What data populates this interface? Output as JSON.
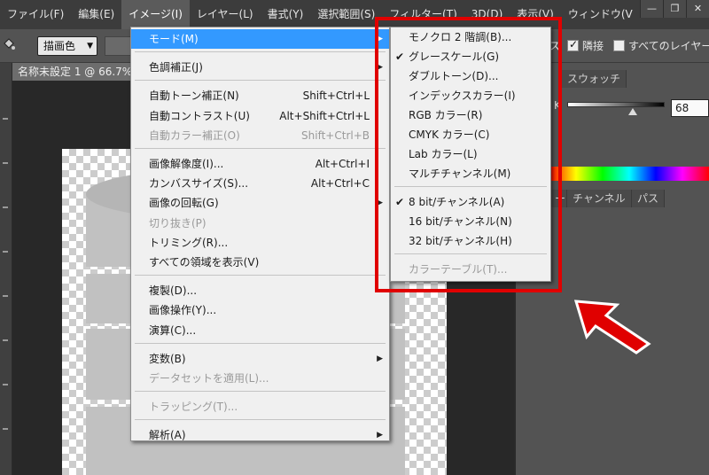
{
  "menubar": {
    "items": [
      "ファイル(F)",
      "編集(E)",
      "イメージ(I)",
      "レイヤー(L)",
      "書式(Y)",
      "選択範囲(S)",
      "フィルター(T)",
      "3D(D)",
      "表示(V)",
      "ウィンドウ(V"
    ],
    "active_index": 2
  },
  "window_controls": {
    "minimize": "—",
    "restore": "❐",
    "close": "✕"
  },
  "options_bar": {
    "mode_select": "描画色",
    "right_partial": "ス",
    "sample_all_label": "隣接",
    "all_layers_label": "すべてのレイヤー"
  },
  "document": {
    "tab_title": "名称未設定 1 @ 66.7%"
  },
  "panels": {
    "top_tab": "スウォッチ",
    "k_label": "K",
    "k_value": "68",
    "lower_tabs": [
      "ー",
      "チャンネル",
      "パス"
    ]
  },
  "image_menu": {
    "items": [
      {
        "label": "モード(M)",
        "shortcut": "",
        "submenu": true,
        "highlight": true,
        "disabled": false
      },
      {
        "sep": true
      },
      {
        "label": "色調補正(J)",
        "shortcut": "",
        "submenu": true,
        "disabled": false
      },
      {
        "sep": true
      },
      {
        "label": "自動トーン補正(N)",
        "shortcut": "Shift+Ctrl+L",
        "disabled": false
      },
      {
        "label": "自動コントラスト(U)",
        "shortcut": "Alt+Shift+Ctrl+L",
        "disabled": false
      },
      {
        "label": "自動カラー補正(O)",
        "shortcut": "Shift+Ctrl+B",
        "disabled": true
      },
      {
        "sep": true
      },
      {
        "label": "画像解像度(I)...",
        "shortcut": "Alt+Ctrl+I",
        "disabled": false
      },
      {
        "label": "カンバスサイズ(S)...",
        "shortcut": "Alt+Ctrl+C",
        "disabled": false
      },
      {
        "label": "画像の回転(G)",
        "shortcut": "",
        "submenu": true,
        "disabled": false
      },
      {
        "label": "切り抜き(P)",
        "shortcut": "",
        "disabled": true
      },
      {
        "label": "トリミング(R)...",
        "shortcut": "",
        "disabled": false
      },
      {
        "label": "すべての領域を表示(V)",
        "shortcut": "",
        "disabled": false
      },
      {
        "sep": true
      },
      {
        "label": "複製(D)...",
        "shortcut": "",
        "disabled": false
      },
      {
        "label": "画像操作(Y)...",
        "shortcut": "",
        "disabled": false
      },
      {
        "label": "演算(C)...",
        "shortcut": "",
        "disabled": false
      },
      {
        "sep": true
      },
      {
        "label": "変数(B)",
        "shortcut": "",
        "submenu": true,
        "disabled": false
      },
      {
        "label": "データセットを適用(L)...",
        "shortcut": "",
        "disabled": true
      },
      {
        "sep": true
      },
      {
        "label": "トラッピング(T)...",
        "shortcut": "",
        "disabled": true
      },
      {
        "sep": true
      },
      {
        "label": "解析(A)",
        "shortcut": "",
        "submenu": true,
        "disabled": false
      }
    ]
  },
  "mode_submenu": {
    "items": [
      {
        "label": "モノクロ 2 階調(B)...",
        "checked": false,
        "disabled": false
      },
      {
        "label": "グレースケール(G)",
        "checked": true,
        "disabled": false
      },
      {
        "label": "ダブルトーン(D)...",
        "checked": false,
        "disabled": false
      },
      {
        "label": "インデックスカラー(I)",
        "checked": false,
        "disabled": false
      },
      {
        "label": "RGB カラー(R)",
        "checked": false,
        "disabled": false
      },
      {
        "label": "CMYK カラー(C)",
        "checked": false,
        "disabled": false
      },
      {
        "label": "Lab カラー(L)",
        "checked": false,
        "disabled": false
      },
      {
        "label": "マルチチャンネル(M)",
        "checked": false,
        "disabled": false
      },
      {
        "sep": true
      },
      {
        "label": "8 bit/チャンネル(A)",
        "checked": true,
        "disabled": false
      },
      {
        "label": "16 bit/チャンネル(N)",
        "checked": false,
        "disabled": false
      },
      {
        "label": "32 bit/チャンネル(H)",
        "checked": false,
        "disabled": false
      },
      {
        "sep": true
      },
      {
        "label": "カラーテーブル(T)...",
        "checked": false,
        "disabled": true
      }
    ]
  },
  "colors": {
    "highlight": "#3399ff",
    "annotation": "#e00000",
    "menu_bg": "#f0f0f0"
  }
}
